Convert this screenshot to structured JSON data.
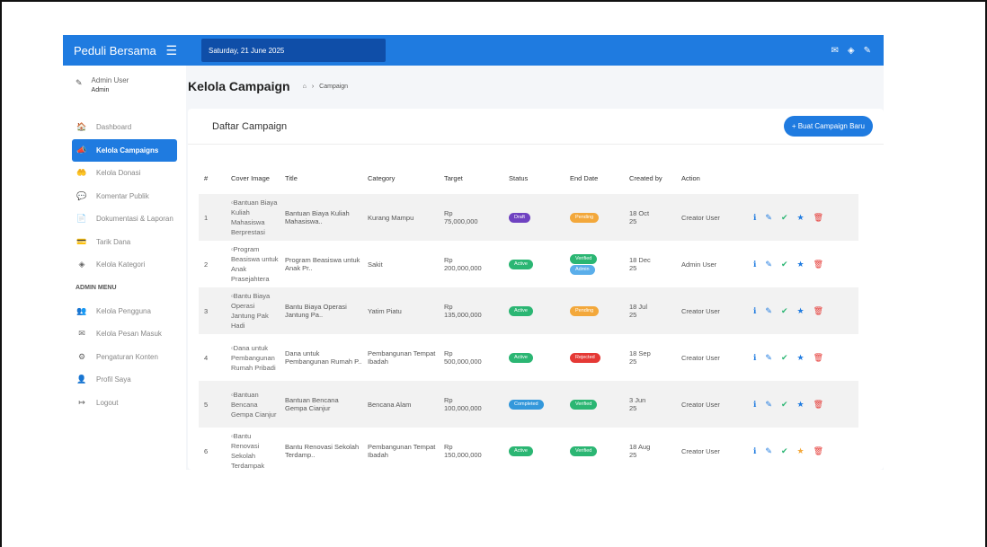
{
  "topbar": {
    "brand": "Peduli Bersama",
    "date": "Saturday, 21 June 2025",
    "icons": [
      "menu-icon",
      "mail-icon",
      "layers-icon",
      "user-icon"
    ]
  },
  "user": {
    "name": "Admin User",
    "role": "Admin"
  },
  "sidebar": {
    "items": [
      {
        "label": "Dashboard",
        "icon": "🏠",
        "active": false
      },
      {
        "label": "Kelola Campaigns",
        "icon": "📣",
        "active": true
      },
      {
        "label": "Kelola Donasi",
        "icon": "🤲",
        "active": false
      },
      {
        "label": "Komentar Publik",
        "icon": "💬",
        "active": false
      },
      {
        "label": "Dokumentasi & Laporan",
        "icon": "📄",
        "active": false
      },
      {
        "label": "Tarik Dana",
        "icon": "💳",
        "active": false
      },
      {
        "label": "Kelola Kategori",
        "icon": "◈",
        "active": false
      }
    ],
    "section": "ADMIN MENU",
    "admin_items": [
      {
        "label": "Kelola Pengguna",
        "icon": "👥"
      },
      {
        "label": "Kelola Pesan Masuk",
        "icon": "✉"
      },
      {
        "label": "Pengaturan Konten",
        "icon": "⚙"
      },
      {
        "label": "Profil Saya",
        "icon": "👤"
      },
      {
        "label": "Logout",
        "icon": "↦"
      }
    ]
  },
  "header": {
    "title": "Kelola Campaign",
    "breadcrumb": "Campaign"
  },
  "card": {
    "title": "Daftar Campaign",
    "new_button": "+ Buat Campaign Baru"
  },
  "table": {
    "columns": [
      "#",
      "Cover Image",
      "Title",
      "Category",
      "Target",
      "Status",
      "End Date",
      "Created by",
      "Action"
    ],
    "rows": [
      {
        "no": "1",
        "cover": "Bantuan Biaya Kuliah Mahasiswa Berprestasi",
        "title": "Bantuan Biaya Kuliah Mahasiswa..",
        "category": "Kurang Mampu",
        "target": "Rp 75,000,000",
        "status": "Draft",
        "status_class": "b-draft",
        "end": [
          "Pending"
        ],
        "end_class": [
          "b-pending"
        ],
        "created": "18 Oct 25",
        "by": "Creator User",
        "star_gold": false
      },
      {
        "no": "2",
        "cover": "Program Beasiswa untuk Anak Prasejahtera",
        "title": "Program Beasiswa untuk Anak Pr..",
        "category": "Sakit",
        "target": "Rp 200,000,000",
        "status": "Active",
        "status_class": "b-active",
        "end": [
          "Verified",
          "Admin"
        ],
        "end_class": [
          "b-verified",
          "b-admin"
        ],
        "created": "18 Dec 25",
        "by": "Admin User",
        "star_gold": false
      },
      {
        "no": "3",
        "cover": "Bantu Biaya Operasi Jantung Pak Hadi",
        "title": "Bantu Biaya Operasi Jantung Pa..",
        "category": "Yatim Piatu",
        "target": "Rp 135,000,000",
        "status": "Active",
        "status_class": "b-active",
        "end": [
          "Pending"
        ],
        "end_class": [
          "b-pending"
        ],
        "created": "18 Jul 25",
        "by": "Creator User",
        "star_gold": false
      },
      {
        "no": "4",
        "cover": "Dana untuk Pembangunan Rumah Pribadi",
        "title": "Dana untuk Pembangunan Rumah P..",
        "category": "Pembangunan Tempat Ibadah",
        "target": "Rp 500,000,000",
        "status": "Active",
        "status_class": "b-active",
        "end": [
          "Rejected"
        ],
        "end_class": [
          "b-rejected"
        ],
        "created": "18 Sep 25",
        "by": "Creator User",
        "star_gold": false
      },
      {
        "no": "5",
        "cover": "Bantuan Bencana Gempa Cianjur",
        "title": "Bantuan Bencana Gempa Cianjur",
        "category": "Bencana Alam",
        "target": "Rp 100,000,000",
        "status": "Completed",
        "status_class": "b-completed",
        "end": [
          "Verified"
        ],
        "end_class": [
          "b-verified"
        ],
        "created": "3 Jun 25",
        "by": "Creator User",
        "star_gold": false
      },
      {
        "no": "6",
        "cover": "Bantu Renovasi Sekolah Terdampak",
        "title": "Bantu Renovasi Sekolah Terdamp..",
        "category": "Pembangunan Tempat Ibadah",
        "target": "Rp 150,000,000",
        "status": "Active",
        "status_class": "b-active",
        "end": [
          "Verified"
        ],
        "end_class": [
          "b-verified"
        ],
        "created": "18 Aug 25",
        "by": "Creator User",
        "star_gold": true
      }
    ]
  }
}
